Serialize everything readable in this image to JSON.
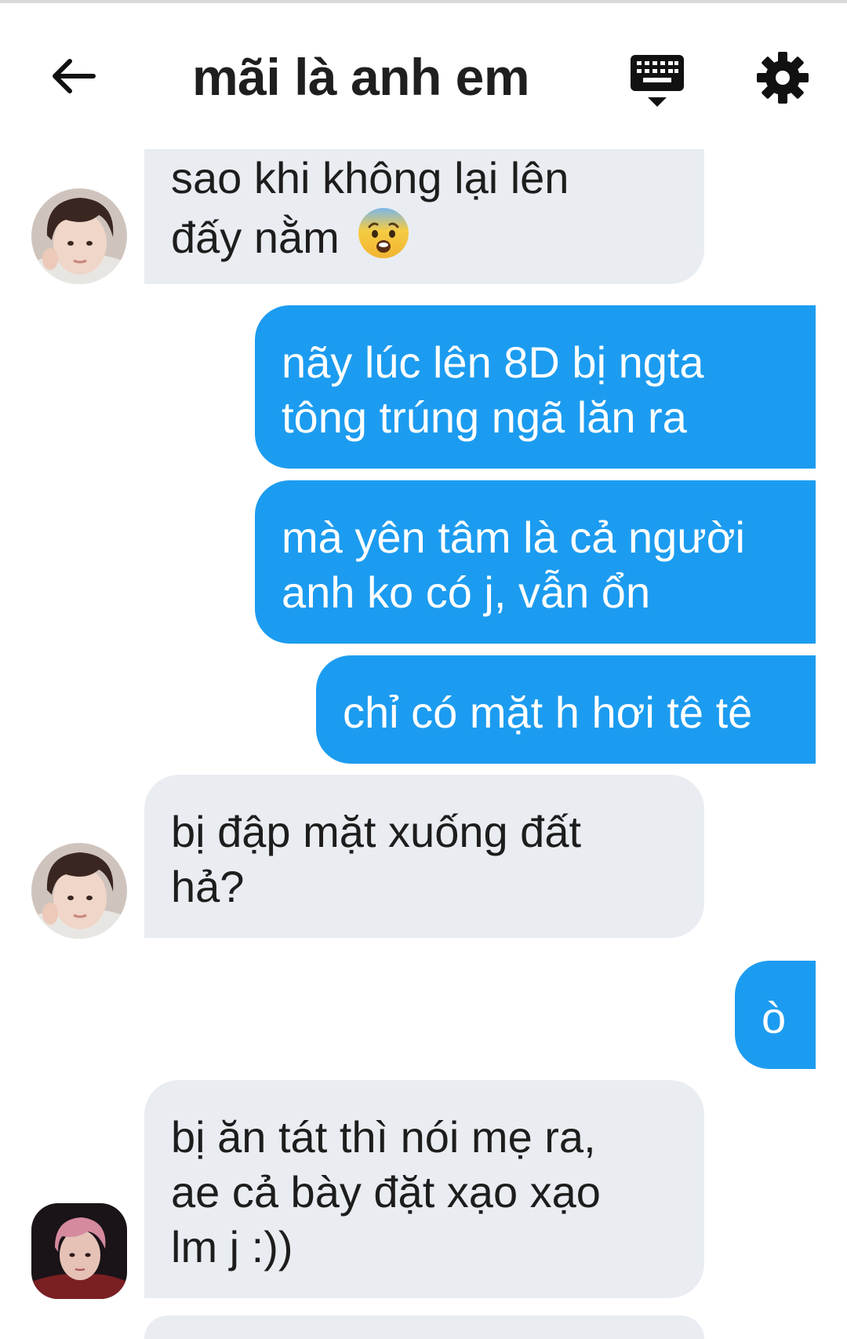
{
  "header": {
    "title": "mãi là anh em",
    "back_icon": "arrow-left-icon",
    "keyboard_icon": "keyboard-icon",
    "settings_icon": "gear-icon"
  },
  "colors": {
    "outgoing_bubble": "#1c9cf0",
    "incoming_bubble": "#e9edf2",
    "text_dark": "#1f1f1f"
  },
  "messages": [
    {
      "side": "incoming",
      "lines": [
        "sao khi không lại lên",
        "đấy nằm"
      ],
      "emoji": "fearful-face-icon"
    },
    {
      "side": "outgoing",
      "lines": [
        "nãy lúc lên 8D bị ngta",
        "tông trúng ngã lăn ra"
      ]
    },
    {
      "side": "outgoing",
      "lines": [
        "mà yên tâm là cả người",
        "anh ko có j, vẫn ổn"
      ]
    },
    {
      "side": "outgoing",
      "lines": [
        "chỉ có mặt h hơi tê tê"
      ]
    },
    {
      "side": "incoming",
      "lines": [
        "bị đập mặt xuống đất",
        "hả?"
      ]
    },
    {
      "side": "outgoing",
      "lines": [
        "ò"
      ]
    },
    {
      "side": "incoming",
      "lines": [
        "bị ăn tát thì nói mẹ ra,",
        "ae cả bày đặt xạo xạo",
        "lm j :))"
      ]
    }
  ]
}
